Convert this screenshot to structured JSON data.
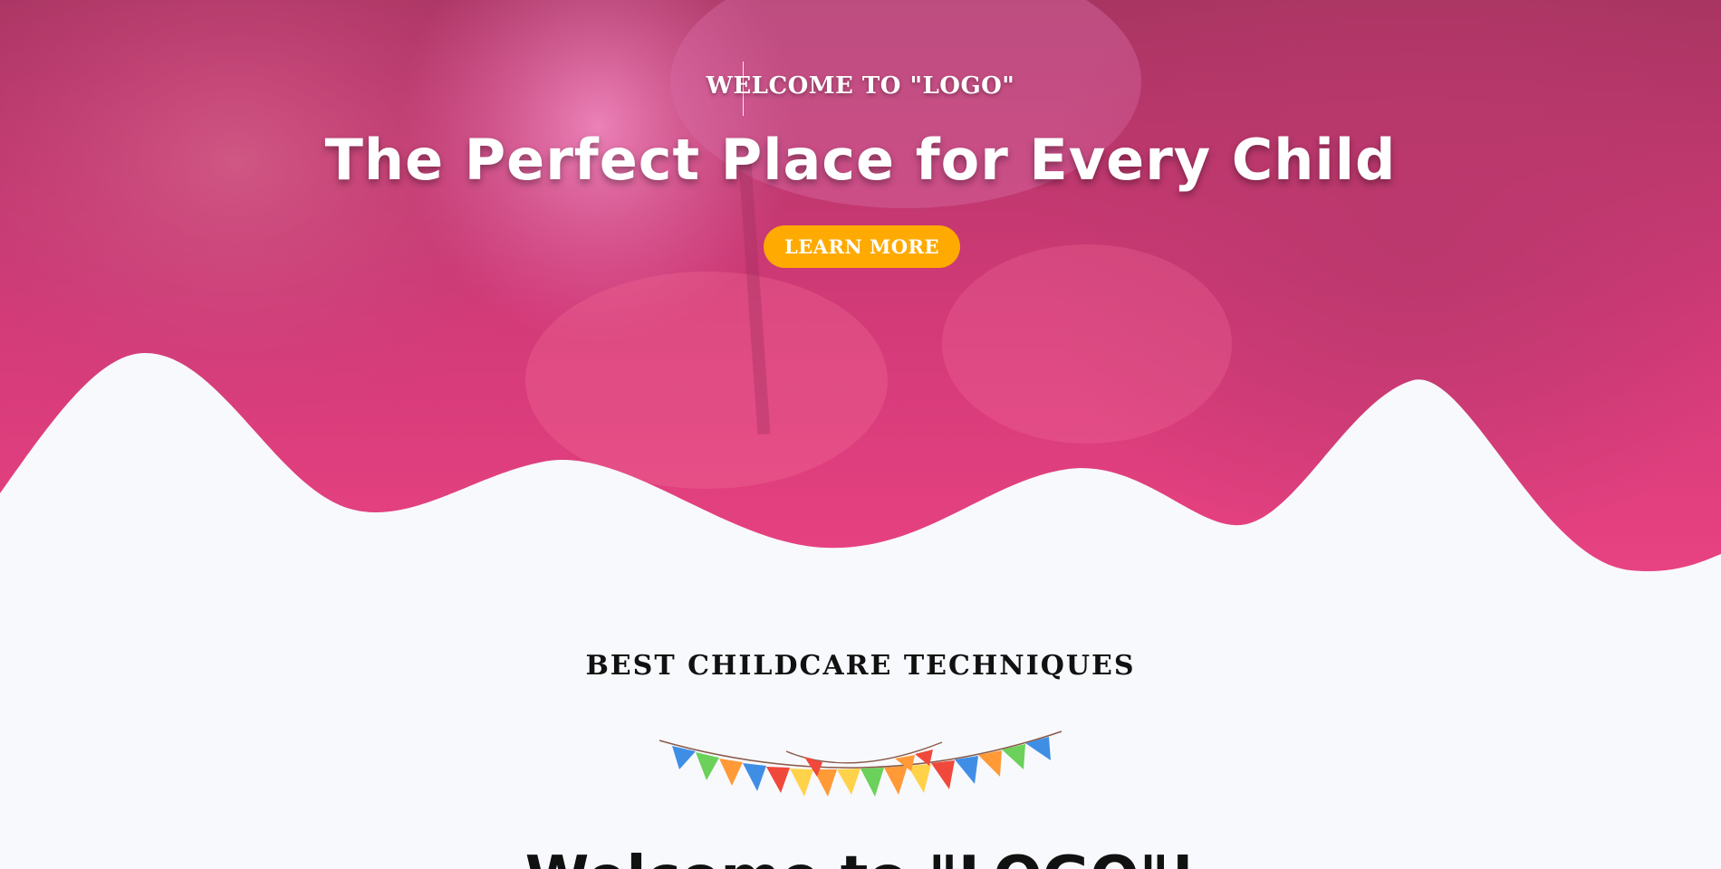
{
  "hero": {
    "eyebrow": "WELCOME TO \"LOGO\"",
    "headline": "The Perfect Place for Every Child",
    "button_label": "LEARN MORE",
    "overlay_color_top": "#c4376f",
    "overlay_color_bottom": "#e84282",
    "button_color": "#ffaa00"
  },
  "section": {
    "title": "BEST CHILDCARE TECHNIQUES",
    "heading_partial": "Welcome to \"LOGO\"!",
    "decoration_icon": "bunting-flags-icon"
  },
  "colors": {
    "page_background": "#f8f9fd",
    "flag_colors": [
      "#3f8ee6",
      "#6bd15a",
      "#ff9a36",
      "#ffd24a",
      "#f0483b"
    ]
  }
}
